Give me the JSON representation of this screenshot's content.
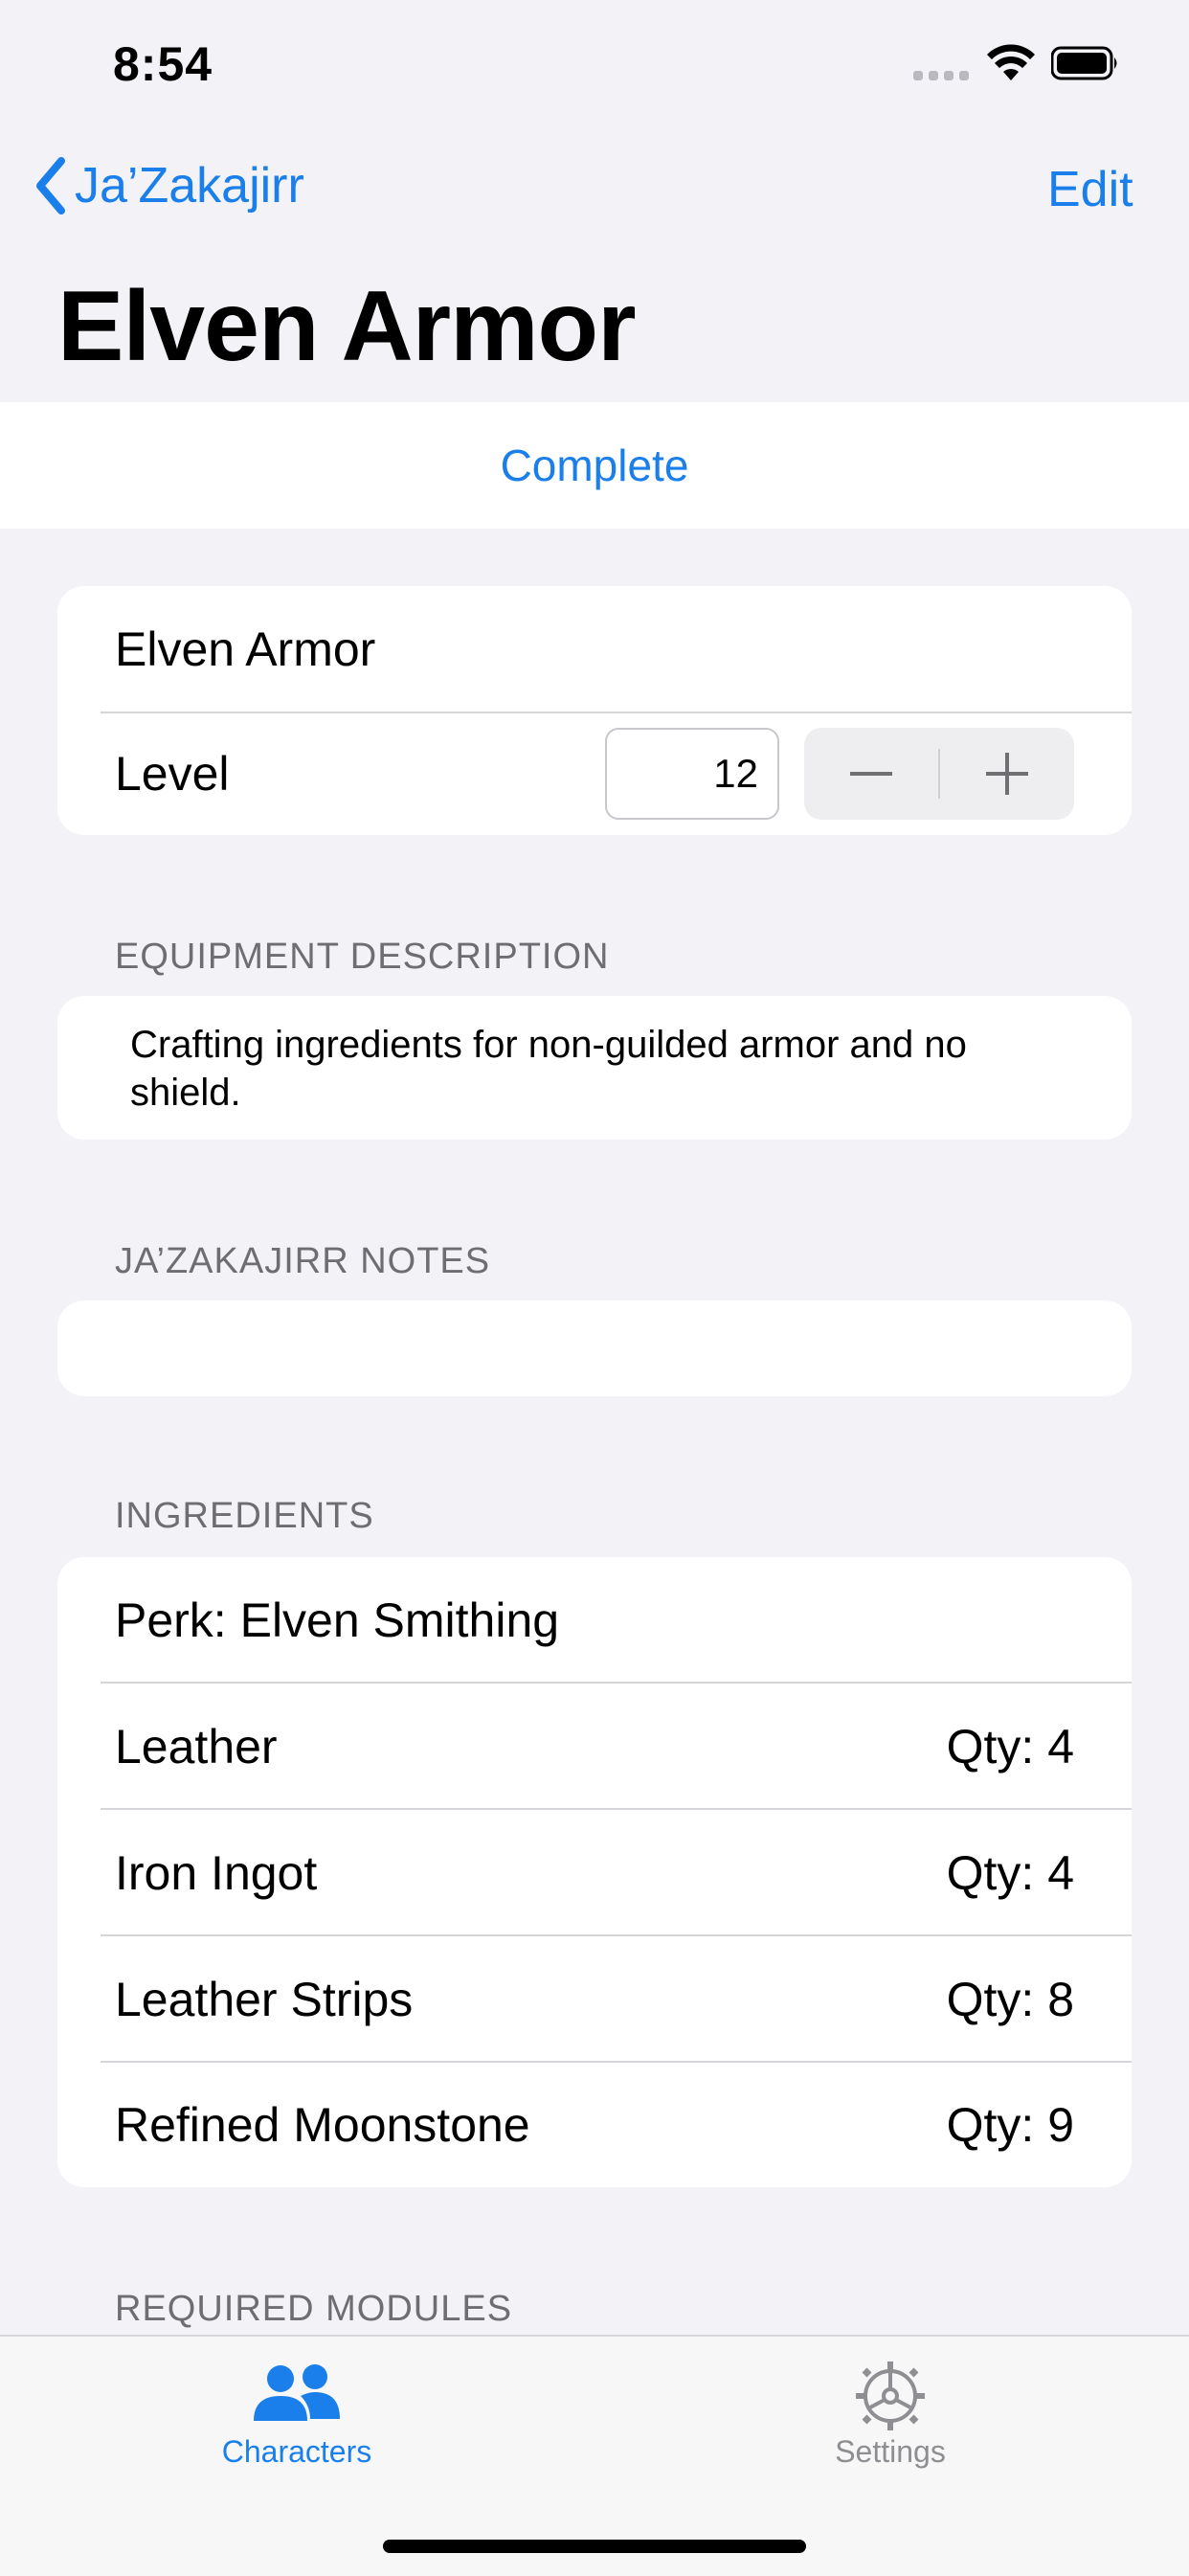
{
  "status": {
    "time": "8:54"
  },
  "nav": {
    "back_label": "Ja’Zakajirr",
    "edit_label": "Edit",
    "title": "Elven Armor"
  },
  "complete_label": "Complete",
  "item": {
    "name": "Elven Armor",
    "level_label": "Level",
    "level_value": "12"
  },
  "description": {
    "header": "EQUIPMENT DESCRIPTION",
    "text": "Crafting ingredients for non-guilded armor and no shield."
  },
  "notes": {
    "header": "JA’ZAKAJIRR NOTES",
    "text": ""
  },
  "ingredients": {
    "header": "INGREDIENTS",
    "perk": "Perk: Elven Smithing",
    "items": [
      {
        "name": "Leather",
        "qty": "Qty: 4"
      },
      {
        "name": "Iron Ingot",
        "qty": "Qty: 4"
      },
      {
        "name": "Leather Strips",
        "qty": "Qty: 8"
      },
      {
        "name": "Refined Moonstone",
        "qty": "Qty: 9"
      }
    ]
  },
  "modules": {
    "header": "REQUIRED MODULES"
  },
  "tabs": [
    {
      "label": "Characters",
      "icon": "people-icon",
      "active": true
    },
    {
      "label": "Settings",
      "icon": "gear-icon",
      "active": false
    }
  ],
  "colors": {
    "accent": "#1A7FEA",
    "background": "#F2F2F7",
    "inactive": "#8E8E93"
  }
}
